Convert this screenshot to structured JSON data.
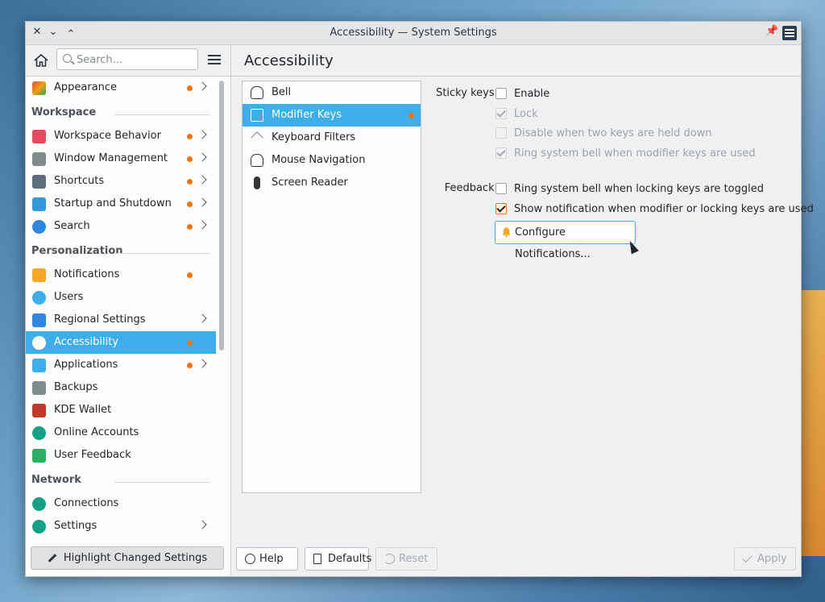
{
  "window": {
    "title": "Accessibility — System Settings"
  },
  "search": {
    "placeholder": "Search..."
  },
  "sidebar": {
    "top_item": {
      "label": "Appearance",
      "changed": true,
      "has_children": true
    },
    "sections": [
      {
        "header": "Workspace",
        "items": [
          {
            "label": "Workspace Behavior",
            "changed": true,
            "has_children": true,
            "icon": "workspace-behavior-icon",
            "color": "#e8495b"
          },
          {
            "label": "Window Management",
            "changed": true,
            "has_children": true,
            "icon": "window-management-icon",
            "color": "#7f8c8d"
          },
          {
            "label": "Shortcuts",
            "changed": true,
            "has_children": true,
            "icon": "keyboard-icon",
            "color": "#5d6d7e"
          },
          {
            "label": "Startup and Shutdown",
            "changed": true,
            "has_children": true,
            "icon": "startup-icon",
            "color": "#3498db"
          },
          {
            "label": "Search",
            "changed": true,
            "has_children": true,
            "icon": "search-icon",
            "color": "#2e86de"
          }
        ]
      },
      {
        "header": "Personalization",
        "items": [
          {
            "label": "Notifications",
            "changed": true,
            "has_children": false,
            "icon": "bell-icon",
            "color": "#f5a623"
          },
          {
            "label": "Users",
            "changed": false,
            "has_children": false,
            "icon": "users-icon",
            "color": "#3daee9"
          },
          {
            "label": "Regional Settings",
            "changed": false,
            "has_children": true,
            "icon": "regional-icon",
            "color": "#2e86de"
          },
          {
            "label": "Accessibility",
            "changed": true,
            "has_children": false,
            "active": true,
            "icon": "accessibility-icon",
            "color": "#1d99f3"
          },
          {
            "label": "Applications",
            "changed": true,
            "has_children": true,
            "icon": "applications-icon",
            "color": "#3daee9"
          },
          {
            "label": "Backups",
            "changed": false,
            "has_children": false,
            "icon": "backups-icon",
            "color": "#7f8c8d"
          },
          {
            "label": "KDE Wallet",
            "changed": false,
            "has_children": false,
            "icon": "wallet-icon",
            "color": "#c0392b"
          },
          {
            "label": "Online Accounts",
            "changed": false,
            "has_children": false,
            "icon": "online-accounts-icon",
            "color": "#16a085"
          },
          {
            "label": "User Feedback",
            "changed": false,
            "has_children": false,
            "icon": "feedback-icon",
            "color": "#27ae60"
          }
        ]
      },
      {
        "header": "Network",
        "items": [
          {
            "label": "Connections",
            "changed": false,
            "has_children": false,
            "icon": "connections-icon",
            "color": "#16a085"
          },
          {
            "label": "Settings",
            "changed": false,
            "has_children": true,
            "icon": "network-settings-icon",
            "color": "#16a085"
          }
        ]
      }
    ],
    "highlight_label": "Highlight Changed Settings"
  },
  "main": {
    "title": "Accessibility",
    "categories": [
      {
        "label": "Bell",
        "icon": "bell-outline-icon",
        "active": false
      },
      {
        "label": "Modifier Keys",
        "icon": "keyboard-icon",
        "active": true,
        "changed": true
      },
      {
        "label": "Keyboard Filters",
        "icon": "filter-icon",
        "active": false
      },
      {
        "label": "Mouse Navigation",
        "icon": "mouse-icon",
        "active": false
      },
      {
        "label": "Screen Reader",
        "icon": "microphone-icon",
        "active": false
      }
    ],
    "sticky_label": "Sticky keys:",
    "sticky": [
      {
        "label": "Enable",
        "checked": false,
        "disabled": false
      },
      {
        "label": "Lock",
        "checked": true,
        "disabled": true
      },
      {
        "label": "Disable when two keys are held down",
        "checked": false,
        "disabled": true
      },
      {
        "label": "Ring system bell when modifier keys are used",
        "checked": true,
        "disabled": true
      }
    ],
    "feedback_label": "Feedback:",
    "feedback": [
      {
        "label": "Ring system bell when locking keys are toggled",
        "checked": false,
        "disabled": false
      },
      {
        "label": "Show notification when modifier or locking keys are used",
        "checked": true,
        "disabled": false
      }
    ],
    "configure_label": "Configure Notifications..."
  },
  "footer": {
    "help": "Help",
    "defaults": "Defaults",
    "reset": "Reset",
    "apply": "Apply"
  }
}
